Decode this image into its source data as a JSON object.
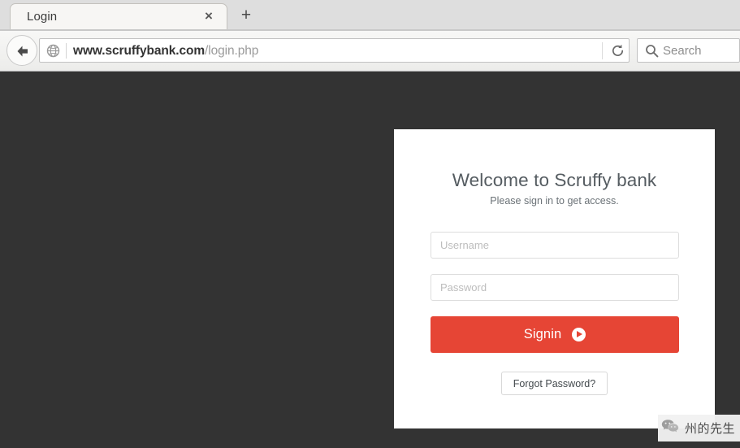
{
  "browser": {
    "tab": {
      "title": "Login",
      "close_label": "×",
      "icon": "close-icon"
    },
    "new_tab_label": "+",
    "back_icon": "back-arrow-icon",
    "globe_icon": "globe-icon",
    "url": {
      "full": "www.scruffybank.com/login.php",
      "host": "www.scruffybank.com",
      "path": "/login.php"
    },
    "reload_icon": "reload-icon",
    "search": {
      "icon": "search-icon",
      "placeholder": "Search",
      "value": ""
    }
  },
  "page": {
    "background_color": "#333333",
    "card": {
      "heading": "Welcome to Scruffy bank",
      "subheading": "Please sign in to get access.",
      "username": {
        "placeholder": "Username",
        "value": ""
      },
      "password": {
        "placeholder": "Password",
        "value": ""
      },
      "signin": {
        "label": "Signin",
        "icon": "play-circle-icon",
        "color": "#e64535"
      },
      "forgot": {
        "label": "Forgot Password?"
      }
    }
  },
  "watermark": {
    "icon": "wechat-icon",
    "text": "州的先生"
  }
}
